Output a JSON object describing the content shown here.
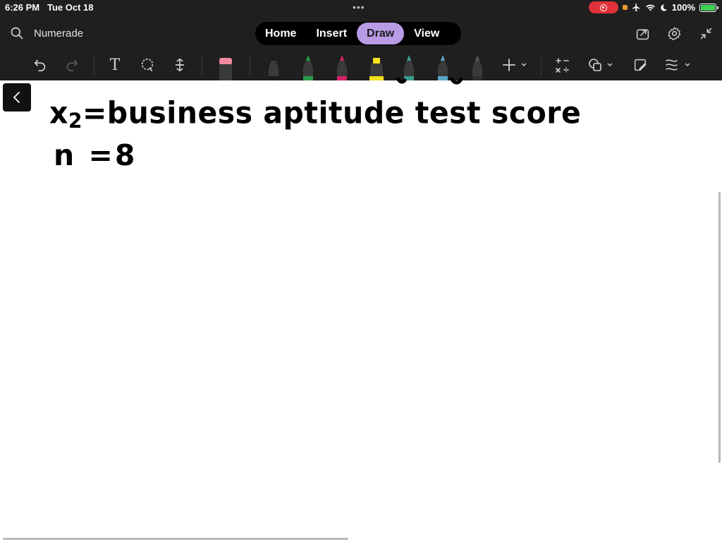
{
  "status_bar": {
    "time": "6:26 PM",
    "date": "Tue Oct 18",
    "dots": "•••",
    "battery_pct": "100%"
  },
  "app": {
    "name": "Numerade"
  },
  "tabs": [
    {
      "label": "Home",
      "active": false
    },
    {
      "label": "Insert",
      "active": false
    },
    {
      "label": "Draw",
      "active": true
    },
    {
      "label": "View",
      "active": false
    }
  ],
  "toolbar": {
    "text_tool_glyph": "T",
    "pen_colors": [
      "#1b1b1b",
      "#2a9a4a",
      "#d8206a",
      "#f5e21b",
      "#3aa08f",
      "#5aa8c8",
      "#2e2e2e"
    ]
  },
  "canvas": {
    "line1_prefix": "x",
    "line1_subscript": "2",
    "line1_rest": "=business aptitude test score",
    "line2": "n =8"
  },
  "colors": {
    "chrome_bg": "#1f1f1f",
    "active_tab": "#b99be6",
    "record_red": "#e0323a",
    "battery_green": "#3ed158"
  }
}
